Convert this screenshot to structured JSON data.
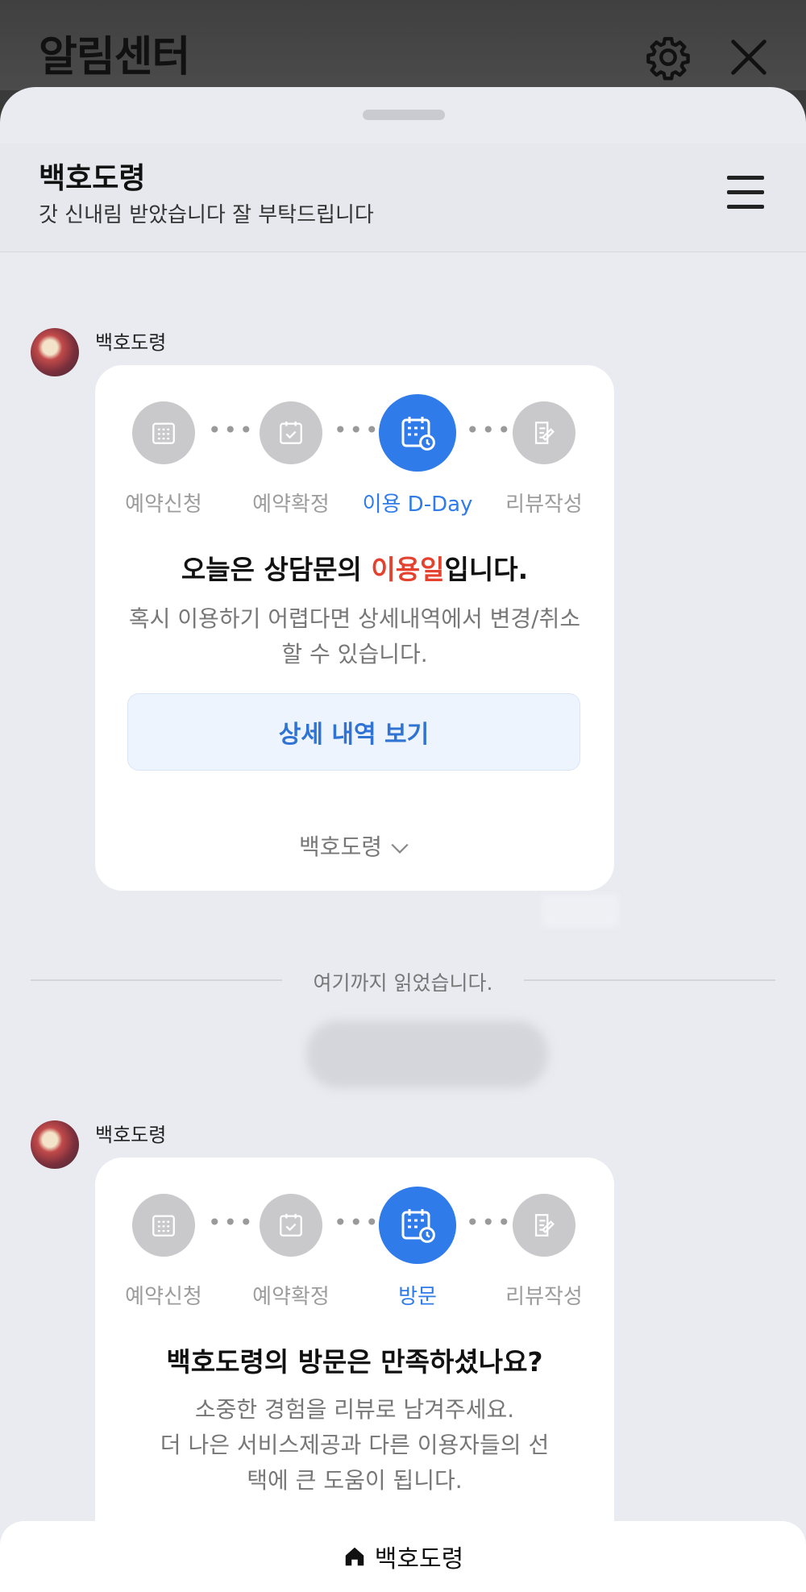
{
  "topbar": {
    "title": "알림센터"
  },
  "chat": {
    "name": "백호도령",
    "subtitle": "갓 신내림 받았습니다 잘 부탁드립니다"
  },
  "messages": [
    {
      "sender": "백호도령",
      "steps": [
        {
          "label": "예약신청",
          "icon": "calendar-grid-icon",
          "active": false
        },
        {
          "label": "예약확정",
          "icon": "calendar-check-icon",
          "active": false
        },
        {
          "label": "이용 D-Day",
          "icon": "calendar-clock-icon",
          "active": true
        },
        {
          "label": "리뷰작성",
          "icon": "review-write-icon",
          "active": false
        }
      ],
      "title_before": "오늘은 상담문의 ",
      "title_highlight": "이용일",
      "title_after": "입니다.",
      "description": "혹시 이용하기 어렵다면 상세내역에서 변경/취소할 수 있습니다.",
      "button_label": "상세 내역 보기",
      "footer": "백호도령"
    },
    {
      "sender": "백호도령",
      "steps": [
        {
          "label": "예약신청",
          "icon": "calendar-grid-icon",
          "active": false
        },
        {
          "label": "예약확정",
          "icon": "calendar-check-icon",
          "active": false
        },
        {
          "label": "방문",
          "icon": "calendar-clock-icon",
          "active": true
        },
        {
          "label": "리뷰작성",
          "icon": "review-write-icon",
          "active": false
        }
      ],
      "title": "백호도령의 방문은 만족하셨나요?",
      "description_lines": [
        "소중한 경험을 리뷰로 남겨주세요.",
        "더 나은 서비스제공과 다른 이용자들의 선",
        "택에 큰 도움이 됩니다."
      ]
    }
  ],
  "divider_text": "여기까지 읽었습니다.",
  "bottom_bar": {
    "label": "백호도령",
    "icon": "home-icon"
  },
  "colors": {
    "accent": "#2f7be9",
    "highlight": "#e4412e",
    "sheet_bg": "#e9ebf1"
  }
}
